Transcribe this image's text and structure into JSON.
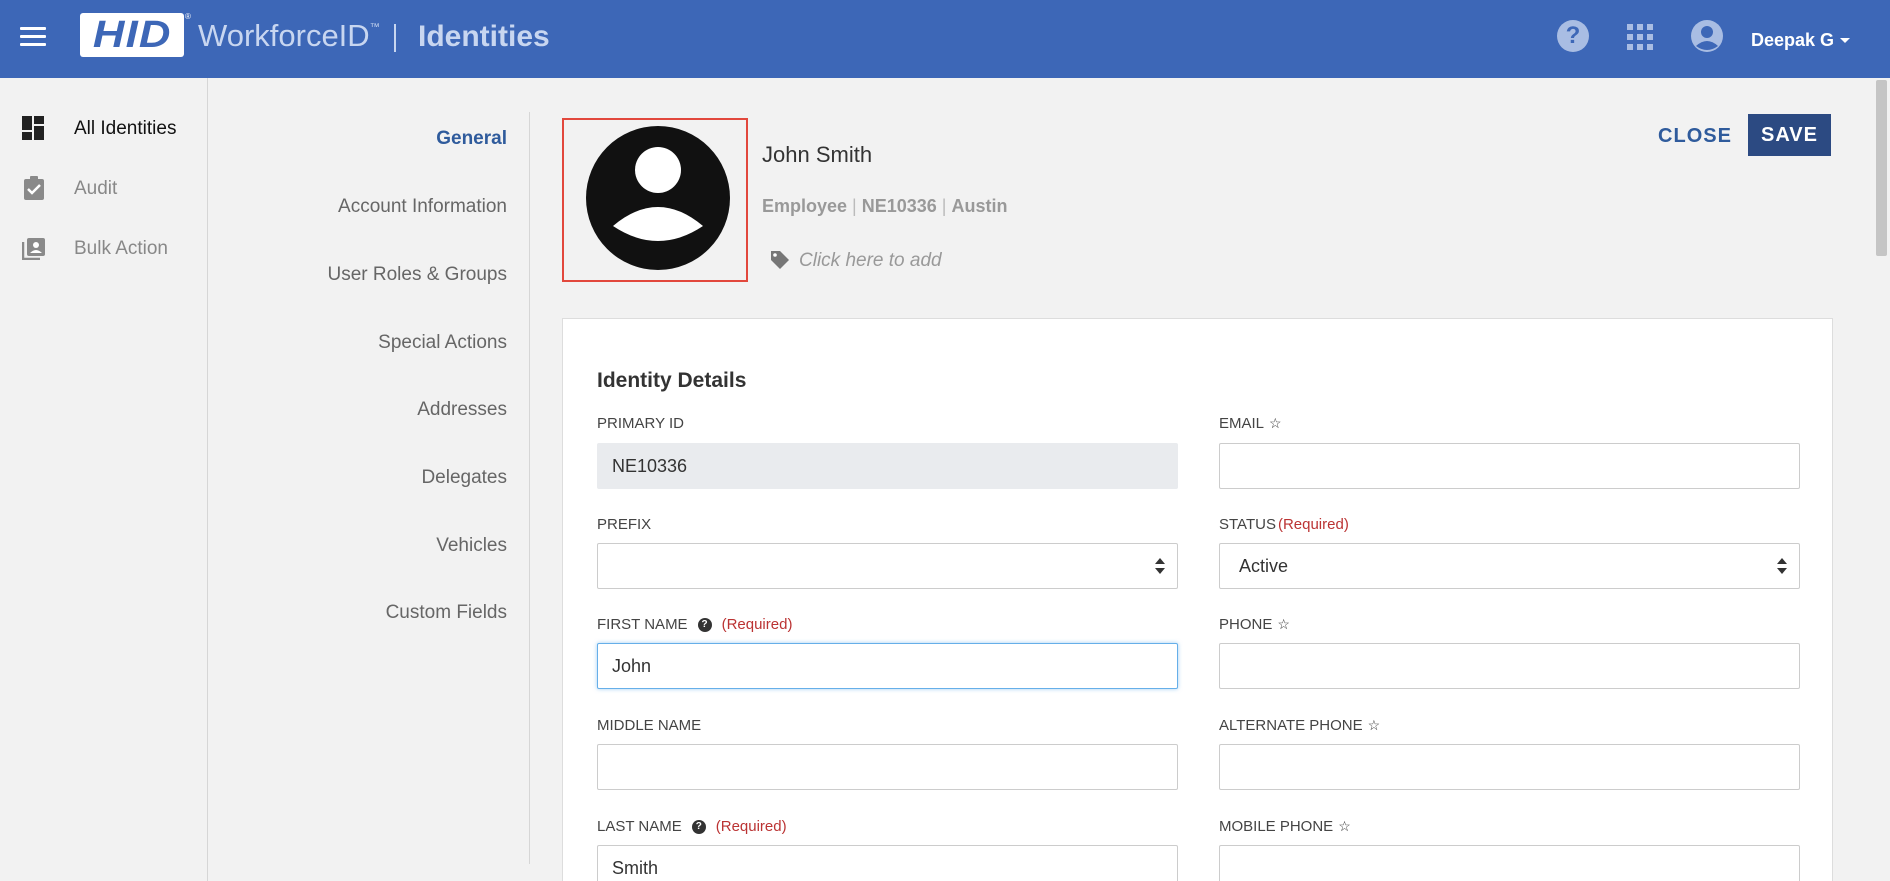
{
  "header": {
    "logo": "HID",
    "logo_mark": "®",
    "app_name": "WorkforceID",
    "app_tm": "™",
    "page_title": "Identities",
    "user_name": "Deepak G",
    "help_icon": "question-circle-icon",
    "apps_icon": "grid-apps-icon",
    "user_icon": "account-circle-icon",
    "bar_color": "#3d67b7"
  },
  "sidenav": {
    "items": [
      {
        "label": "All Identities",
        "icon": "dashboard-icon",
        "active": true
      },
      {
        "label": "Audit",
        "icon": "clipboard-check-icon",
        "active": false
      },
      {
        "label": "Bulk Action",
        "icon": "contacts-icon",
        "active": false
      }
    ]
  },
  "sections": {
    "items": [
      {
        "label": "General",
        "active": true
      },
      {
        "label": "Account Information"
      },
      {
        "label": "User Roles & Groups"
      },
      {
        "label": "Special Actions"
      },
      {
        "label": "Addresses"
      },
      {
        "label": "Delegates"
      },
      {
        "label": "Vehicles"
      },
      {
        "label": "Custom Fields"
      }
    ]
  },
  "profile": {
    "name": "John Smith",
    "type": "Employee",
    "id": "NE10336",
    "location": "Austin",
    "meta_sep": "|",
    "tag_placeholder": "Click here to add",
    "avatar_border_color": "#e2483d"
  },
  "actions": {
    "close_label": "CLOSE",
    "save_label": "SAVE",
    "save_color": "#2c4a82"
  },
  "form": {
    "title": "Identity Details",
    "required_text": "(Required)",
    "primary_id": {
      "label": "PRIMARY ID",
      "value": "NE10336"
    },
    "email": {
      "label": "EMAIL",
      "value": ""
    },
    "prefix": {
      "label": "PREFIX",
      "value": ""
    },
    "status": {
      "label": "STATUS",
      "value": "Active"
    },
    "first_name": {
      "label": "FIRST NAME",
      "value": "John"
    },
    "phone": {
      "label": "PHONE",
      "value": ""
    },
    "middle_name": {
      "label": "MIDDLE NAME",
      "value": ""
    },
    "alternate_phone": {
      "label": "ALTERNATE PHONE",
      "value": ""
    },
    "last_name": {
      "label": "LAST NAME",
      "value": "Smith"
    },
    "mobile_phone": {
      "label": "MOBILE PHONE",
      "value": ""
    },
    "star_glyph": "☆",
    "help_glyph": "?"
  }
}
